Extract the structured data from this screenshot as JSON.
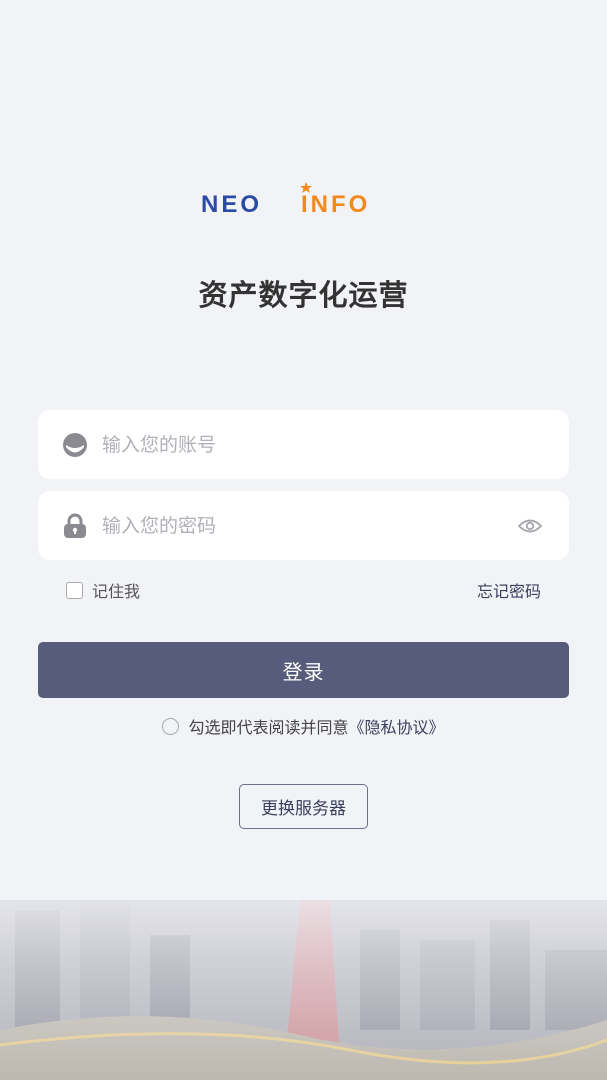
{
  "brand": {
    "logo_part1": "NEO",
    "logo_part2": "INFO",
    "app_title": "资产数字化运营"
  },
  "login_form": {
    "account_placeholder": "输入您的账号",
    "password_placeholder": "输入您的密码",
    "remember_label": "记住我",
    "forgot_label": "忘记密码",
    "submit_label": "登录"
  },
  "agreement": {
    "prefix": "勾选即代表阅读并同意",
    "link": "《隐私协议》"
  },
  "server": {
    "switch_label": "更换服务器"
  },
  "colors": {
    "background": "#f2f3f7",
    "primary_button": "#575c7c",
    "logo_blue": "#2b4aa3",
    "logo_orange": "#f08a1f"
  },
  "icons": [
    "user-icon",
    "lock-icon",
    "eye-icon"
  ]
}
